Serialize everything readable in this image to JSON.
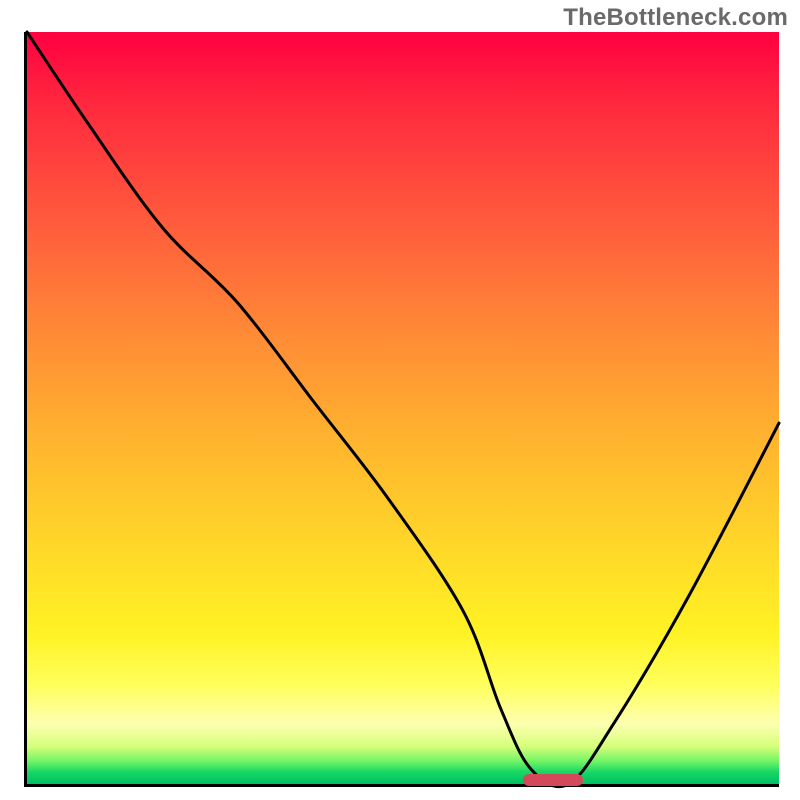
{
  "watermark": "TheBottleneck.com",
  "chart_data": {
    "type": "line",
    "title": "",
    "xlabel": "",
    "ylabel": "",
    "xlim": [
      0,
      100
    ],
    "ylim": [
      0,
      100
    ],
    "grid": false,
    "legend": false,
    "background_gradient": [
      {
        "pos": 0,
        "color": "#ff0040"
      },
      {
        "pos": 25,
        "color": "#ff5a3c"
      },
      {
        "pos": 55,
        "color": "#ffb62e"
      },
      {
        "pos": 80,
        "color": "#fff224"
      },
      {
        "pos": 92,
        "color": "#fdffb0"
      },
      {
        "pos": 100,
        "color": "#00bf63"
      }
    ],
    "series": [
      {
        "name": "bottleneck-curve",
        "x": [
          0,
          8,
          18,
          28,
          38,
          48,
          58,
          63,
          67,
          72,
          78,
          88,
          100
        ],
        "y": [
          100,
          88,
          74,
          64,
          51,
          38,
          23,
          10,
          2,
          0,
          8,
          25,
          48
        ]
      }
    ],
    "annotations": [
      {
        "name": "optimal-marker",
        "type": "bar",
        "x_start": 66,
        "x_end": 74,
        "y": 0,
        "color": "#d24a59"
      }
    ]
  }
}
